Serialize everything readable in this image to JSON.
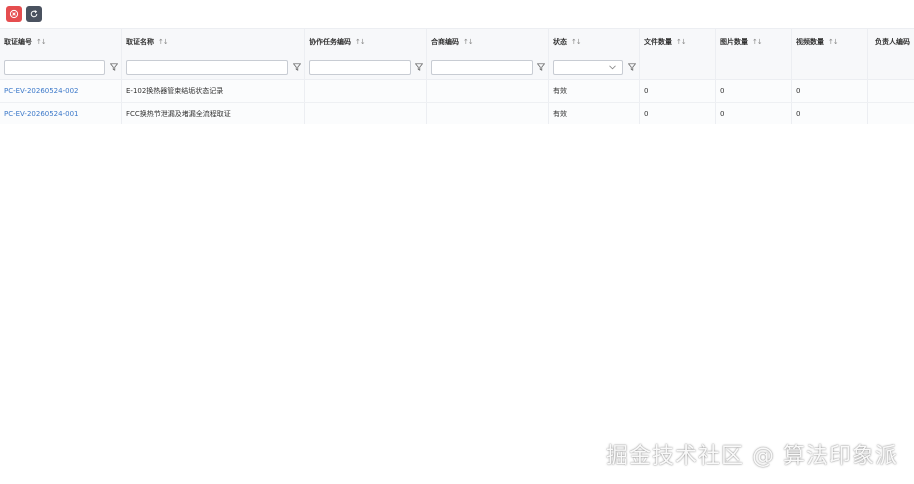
{
  "toolbar": {
    "buttons": [
      {
        "icon": "close-circle-icon",
        "color": "#e54d4f"
      },
      {
        "icon": "refresh-icon",
        "color": "#4a5260"
      }
    ]
  },
  "table": {
    "columns": [
      {
        "label": "取证编号",
        "sortable": true,
        "filter": "text"
      },
      {
        "label": "取证名称",
        "sortable": true,
        "filter": "text"
      },
      {
        "label": "协作任务编码",
        "sortable": true,
        "filter": "text"
      },
      {
        "label": "合商编码",
        "sortable": true,
        "filter": "text"
      },
      {
        "label": "状态",
        "sortable": true,
        "filter": "select"
      },
      {
        "label": "文件数量",
        "sortable": true,
        "filter": "none"
      },
      {
        "label": "图片数量",
        "sortable": true,
        "filter": "none"
      },
      {
        "label": "视频数量",
        "sortable": true,
        "filter": "none"
      },
      {
        "label": "负责人编码",
        "sortable": false,
        "filter": "none"
      }
    ],
    "sort_glyph": "↑↓",
    "rows": [
      {
        "code": "PC-EV-20260524-002",
        "name": "E-102换热器管束结垢状态记录",
        "task_code": "",
        "merchant_code": "",
        "status": "有效",
        "files": "0",
        "images": "0",
        "videos": "0",
        "owner": ""
      },
      {
        "code": "PC-EV-20260524-001",
        "name": "FCC换热节泄漏及堵漏全流程取证",
        "task_code": "",
        "merchant_code": "",
        "status": "有效",
        "files": "0",
        "images": "0",
        "videos": "0",
        "owner": ""
      }
    ]
  },
  "watermark": "掘金技术社区 @ 算法印象派",
  "colors": {
    "link": "#3b78c9",
    "header_bg": "#f7f8fa"
  }
}
